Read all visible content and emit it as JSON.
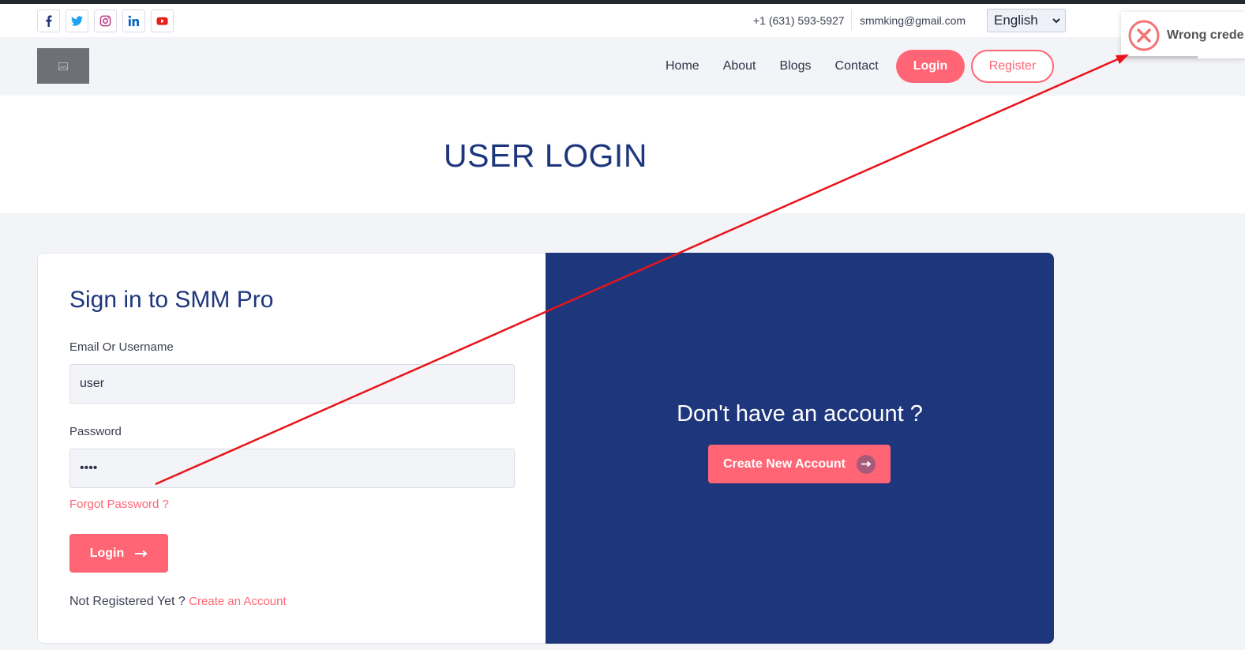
{
  "topbar": {
    "social": [
      "facebook-icon",
      "twitter-icon",
      "instagram-icon",
      "linkedin-icon",
      "youtube-icon"
    ],
    "phone": "+1 (631) 593-5927",
    "email": "smmking@gmail.com",
    "language": "English"
  },
  "nav": {
    "links": [
      "Home",
      "About",
      "Blogs",
      "Contact"
    ],
    "login_label": "Login",
    "register_label": "Register"
  },
  "toast": {
    "message": "Wrong crede",
    "icon": "error-x-icon"
  },
  "hero": {
    "title": "USER LOGIN"
  },
  "login_form": {
    "title": "Sign in to SMM Pro",
    "email_label": "Email Or Username",
    "email_value": "user",
    "password_label": "Password",
    "password_value": "••••",
    "forgot_label": "Forgot Password ?",
    "submit_label": "Login",
    "not_registered": "Not Registered Yet ?",
    "create_link": "Create an Account"
  },
  "register_panel": {
    "heading": "Don't have an account ?",
    "button_label": "Create New Account"
  },
  "colors": {
    "accent": "#ff6575",
    "navy": "#1e367c",
    "annotation": "#e8141a"
  }
}
